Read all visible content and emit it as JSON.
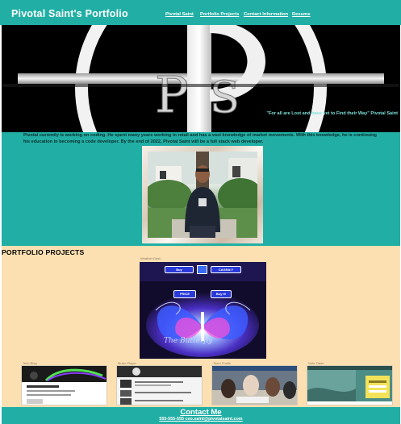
{
  "header": {
    "title": "Pivotal Saint's Portfolio",
    "nav": [
      {
        "label": "Pivotal Saint"
      },
      {
        "label": "Portfolio Projects"
      },
      {
        "label": "Contact Information"
      },
      {
        "label": "Resume"
      }
    ]
  },
  "hero": {
    "quote": "\"For all are Lost and have yet to Find their Way\" Pivotal Saint"
  },
  "about": {
    "text": "Pivotal currently is working on coding. He spent many years working in retail and has a vast knowledge of market movements. With this knowledge, he is continuing his education in becoming a code developer. By the end of 2022, Pivotal Saint will be a full stack web developer."
  },
  "portfolio": {
    "heading": "PORTFOLIO PROJECTS",
    "featured": {
      "caption": "Weather Dash",
      "buttons": [
        "Buy",
        "CAGRA!?",
        "PRICE",
        "Buy it!"
      ],
      "overlay_text": "The Butterfly"
    },
    "thumbs": [
      {
        "caption": "Tech Blog"
      },
      {
        "caption": "Music Player"
      },
      {
        "caption": "Team Profile"
      },
      {
        "caption": "Note Taker"
      }
    ]
  },
  "footer": {
    "title": "Contact Me",
    "line": "555-555-555 ceo.saint@pivotalsaint.com"
  },
  "colors": {
    "teal": "#21afa5",
    "peach": "#fde0b1",
    "black": "#000000"
  }
}
